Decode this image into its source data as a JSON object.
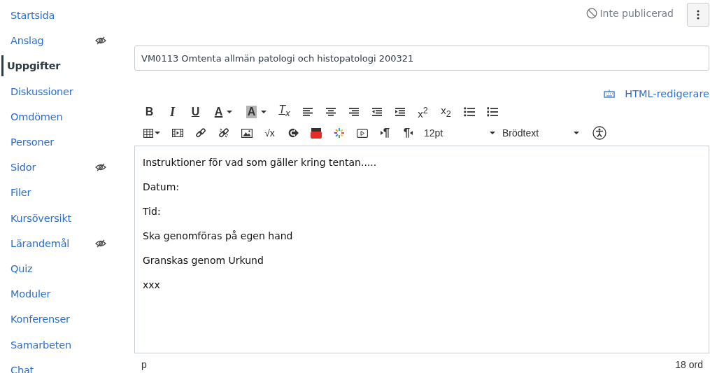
{
  "sidebar": {
    "items": [
      {
        "label": "Startsida",
        "selected": false,
        "hidden": false
      },
      {
        "label": "Anslag",
        "selected": false,
        "hidden": true
      },
      {
        "label": "Uppgifter",
        "selected": true,
        "hidden": false
      },
      {
        "label": "Diskussioner",
        "selected": false,
        "hidden": false
      },
      {
        "label": "Omdömen",
        "selected": false,
        "hidden": false
      },
      {
        "label": "Personer",
        "selected": false,
        "hidden": false
      },
      {
        "label": "Sidor",
        "selected": false,
        "hidden": true
      },
      {
        "label": "Filer",
        "selected": false,
        "hidden": false
      },
      {
        "label": "Kursöversikt",
        "selected": false,
        "hidden": false
      },
      {
        "label": "Lärandemål",
        "selected": false,
        "hidden": true
      },
      {
        "label": "Quiz",
        "selected": false,
        "hidden": false
      },
      {
        "label": "Moduler",
        "selected": false,
        "hidden": false
      },
      {
        "label": "Konferenser",
        "selected": false,
        "hidden": false
      },
      {
        "label": "Samarbeten",
        "selected": false,
        "hidden": false
      },
      {
        "label": "Chat",
        "selected": false,
        "hidden": false
      }
    ]
  },
  "header": {
    "status": "Inte publicerad",
    "published": false
  },
  "title_field": {
    "value": "VM0113 Omtenta allmän patologi och histopatologi 200321"
  },
  "html_editor_link": "HTML-redigerare",
  "toolbar": {
    "rows": [
      [
        {
          "kind": "bold",
          "glyph": "B"
        },
        {
          "kind": "italic",
          "glyph": "I"
        },
        {
          "kind": "underline",
          "glyph": "U"
        },
        {
          "kind": "text-color",
          "glyph": "A"
        },
        {
          "kind": "background-color",
          "glyph": "A"
        },
        {
          "kind": "clear-format",
          "glyph": "T$_{x}$"
        },
        {
          "kind": "align-left"
        },
        {
          "kind": "align-center"
        },
        {
          "kind": "align-right"
        },
        {
          "kind": "outdent"
        },
        {
          "kind": "indent"
        },
        {
          "kind": "superscript",
          "glyph": "x$^{2}$"
        },
        {
          "kind": "subscript",
          "glyph": "x$_{2}$"
        },
        {
          "kind": "bullet-list"
        },
        {
          "kind": "numbered-list"
        }
      ],
      [
        {
          "kind": "table"
        },
        {
          "kind": "media"
        },
        {
          "kind": "link"
        },
        {
          "kind": "unlink"
        },
        {
          "kind": "image"
        },
        {
          "kind": "equation",
          "glyph": "√x"
        },
        {
          "kind": "share"
        },
        {
          "kind": "youtube"
        },
        {
          "kind": "apps"
        },
        {
          "kind": "video"
        },
        {
          "kind": "ltr",
          "glyph": "¶"
        },
        {
          "kind": "rtl",
          "glyph": "¶"
        },
        {
          "kind": "dropdown",
          "value": "12pt"
        },
        {
          "kind": "dropdown",
          "value": "Brödtext"
        },
        {
          "kind": "accessibility"
        }
      ]
    ]
  },
  "editor": {
    "paragraphs": [
      "Instruktioner för vad som gäller kring tentan.....",
      "Datum:",
      "Tid:",
      "Ska genomföras på egen hand",
      "Granskas genom Urkund",
      "xxx"
    ]
  },
  "status_bar": {
    "path": "p",
    "word_count": "18 ord"
  }
}
